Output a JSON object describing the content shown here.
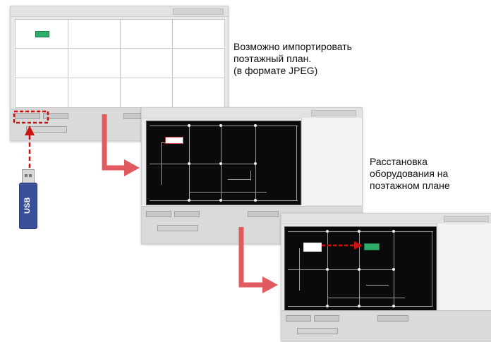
{
  "captions": {
    "import": [
      "Возможно импортировать",
      "поэтажный план.",
      "(в формате JPEG)"
    ],
    "placement": [
      "Расстановка",
      "оборудования на",
      "поэтажном плане"
    ]
  },
  "usb": {
    "label": "USB",
    "color": "#3a4f9a"
  },
  "colors": {
    "arrow": "#e05a5f",
    "highlight_dashed": "#cc1111",
    "device": "#2fae6b",
    "floor_plan_bg": "#0a0a0a"
  },
  "screens": [
    {
      "name": "import-screen",
      "content": "empty-grid-with-device"
    },
    {
      "name": "floorplan-screen",
      "content": "imported-jpeg-floor-plan"
    },
    {
      "name": "placement-screen",
      "content": "floor-plan-with-device-moved"
    }
  ]
}
